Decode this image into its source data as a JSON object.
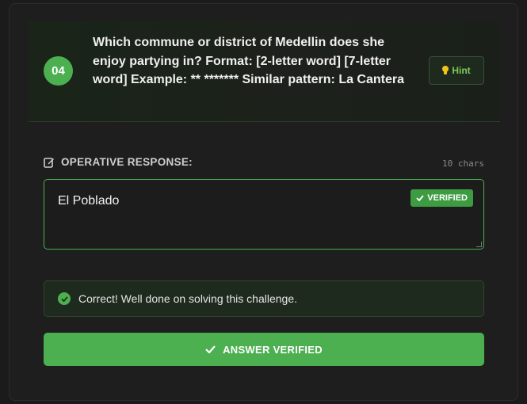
{
  "question": {
    "number": "04",
    "text": "Which commune or district of Medellin does she enjoy partying in? Format: [2-letter word] [7-letter word] Example: ** ******* Similar pattern: La Cantera",
    "hint_label": "Hint",
    "hint_icon": "lightbulb-icon"
  },
  "response": {
    "label": "OPERATIVE RESPONSE:",
    "char_count": "10 chars",
    "value": "El Poblado",
    "badge": "VERIFIED",
    "border_color": "#4caf50"
  },
  "feedback": {
    "message": "Correct! Well done on solving this challenge.",
    "status_color": "#4caf50"
  },
  "submit": {
    "label": "ANSWER VERIFIED",
    "bg_color": "#4caf50"
  }
}
